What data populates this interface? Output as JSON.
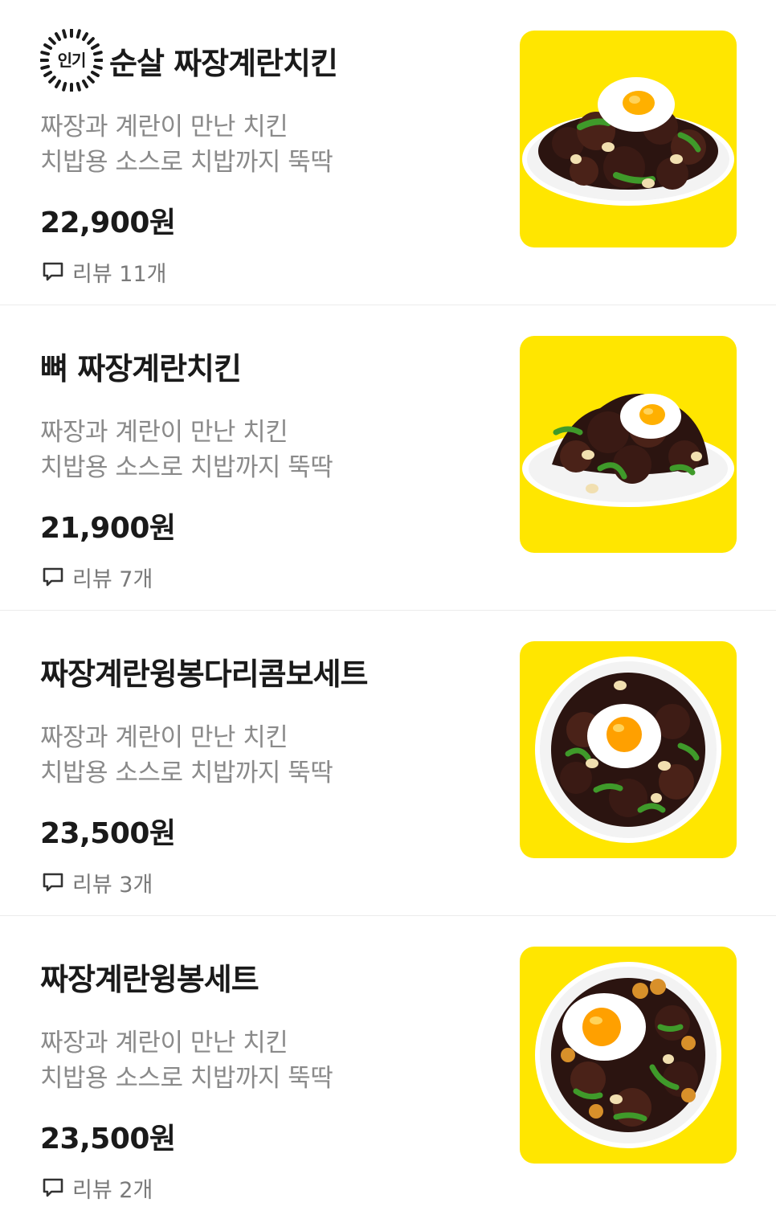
{
  "colors": {
    "tile_background": "#ffe600",
    "title_text": "#1a1a1a",
    "description_text": "#8a8a8a",
    "review_text": "#7a7a7a",
    "divider": "#ececec"
  },
  "icons": {
    "popular_badge": "sunburst-badge-icon",
    "review": "speech-bubble-icon"
  },
  "menu_items": [
    {
      "badge": "인기",
      "title": "순살 짜장계란치킨",
      "description_line1": "짜장과 계란이 만난 치킨",
      "description_line2": "치밥용 소스로 치밥까지 뚝딱",
      "price": "22,900원",
      "review": "리뷰 11개",
      "image_icon": "jjajang-egg-chicken-boneless-plate-image"
    },
    {
      "title": "뼈 짜장계란치킨",
      "description_line1": "짜장과 계란이 만난 치킨",
      "description_line2": "치밥용 소스로 치밥까지 뚝딱",
      "price": "21,900원",
      "review": "리뷰 7개",
      "image_icon": "jjajang-egg-chicken-bone-plate-image"
    },
    {
      "title": "짜장계란윙봉다리콤보세트",
      "description_line1": "짜장과 계란이 만난 치킨",
      "description_line2": "치밥용 소스로 치밥까지 뚝딱",
      "price": "23,500원",
      "review": "리뷰 3개",
      "image_icon": "jjajang-egg-wing-drumstick-combo-plate-image"
    },
    {
      "title": "짜장계란윙봉세트",
      "description_line1": "짜장과 계란이 만난 치킨",
      "description_line2": "치밥용 소스로 치밥까지 뚝딱",
      "price": "23,500원",
      "review": "리뷰 2개",
      "image_icon": "jjajang-egg-wingbong-set-plate-image"
    }
  ]
}
